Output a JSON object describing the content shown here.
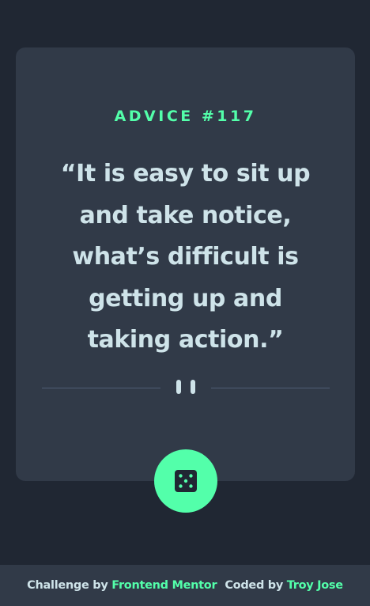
{
  "advice": {
    "id_label": "ADVICE #117",
    "quote": "“It is easy to sit up and take notice, what’s difficult is getting up and taking action.”"
  },
  "icons": {
    "divider": "pause-icon",
    "generate": "dice-icon"
  },
  "colors": {
    "background": "#202733",
    "card": "#313a48",
    "accent": "#53ffaa",
    "text": "#cee3e9",
    "divider": "#4f5d74"
  },
  "footer": {
    "challenge_prefix": "Challenge by",
    "challenge_link": "Frontend Mentor",
    "coded_prefix": "Coded by",
    "coded_link": "Troy Jose"
  }
}
